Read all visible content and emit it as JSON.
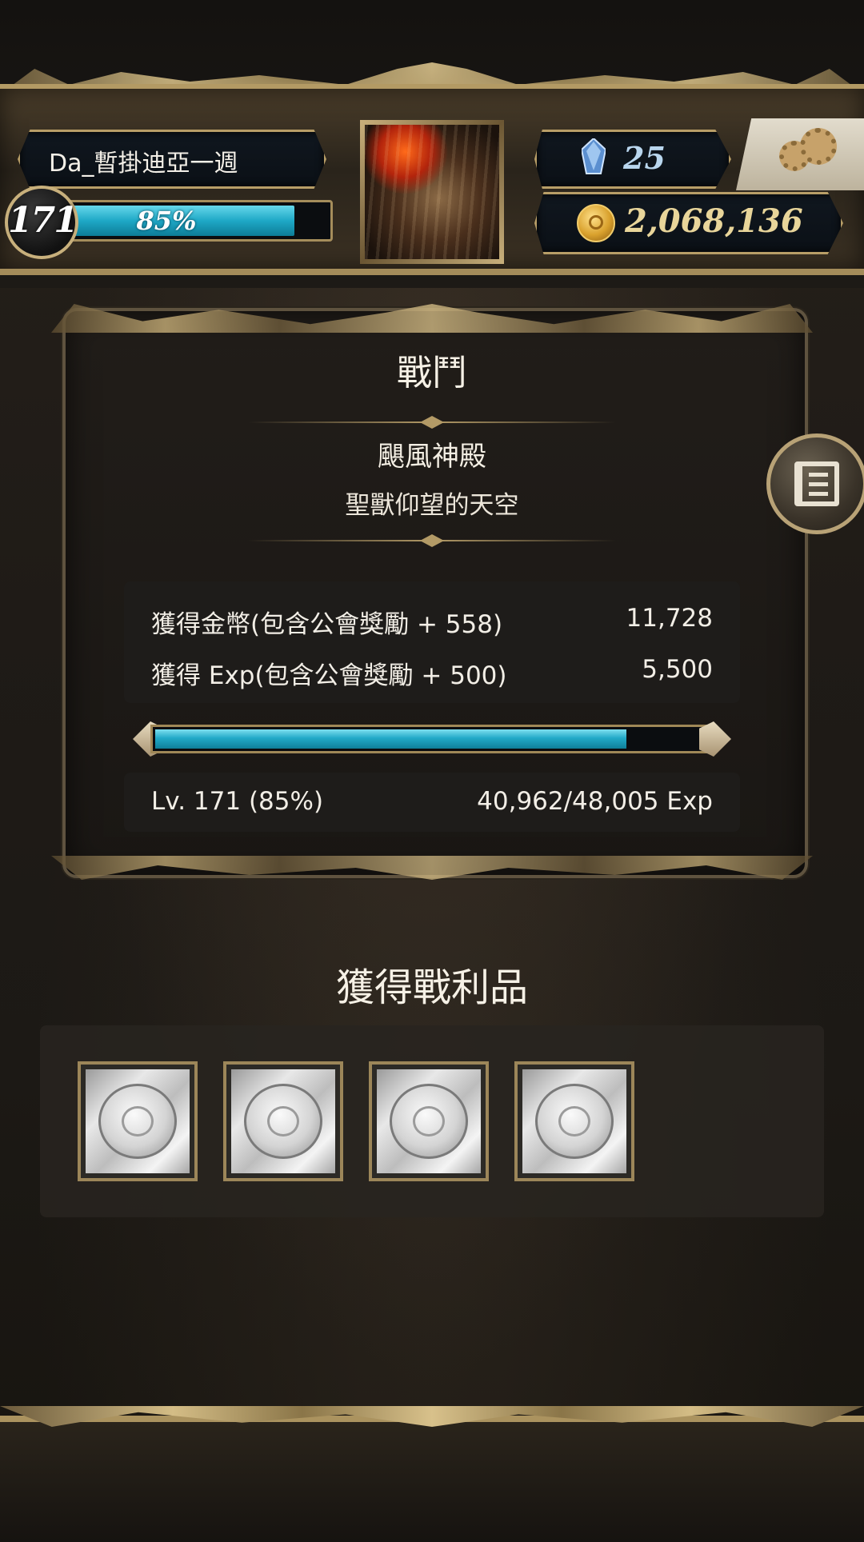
{
  "header": {
    "player_name": "Da_暫掛迪亞一週",
    "level": "171",
    "exp_percent_label": "85%",
    "exp_fraction": 0.85,
    "gem_count": "25",
    "gold_count": "2,068,136"
  },
  "battle": {
    "title": "戰鬥",
    "stage_name": "颶風神殿",
    "stage_subtitle": "聖獸仰望的天空",
    "gold_label": "獲得金幣(包含公會獎勵 + 558)",
    "gold_value": "11,728",
    "exp_label": "獲得 Exp(包含公會獎勵 + 500)",
    "exp_value": "5,500",
    "exp_bar_fraction": 0.853,
    "level_label": "Lv. 171 (85%)",
    "level_exp": "40,962/48,005 Exp"
  },
  "loot": {
    "title": "獲得戰利品",
    "items": [
      "silver-medal-card",
      "silver-medal-card",
      "silver-medal-card",
      "silver-medal-card"
    ]
  },
  "colors": {
    "accent_cyan": "#1ea8c6",
    "gold_trim": "#b89e67",
    "panel_bg": "#1e1c1a"
  }
}
